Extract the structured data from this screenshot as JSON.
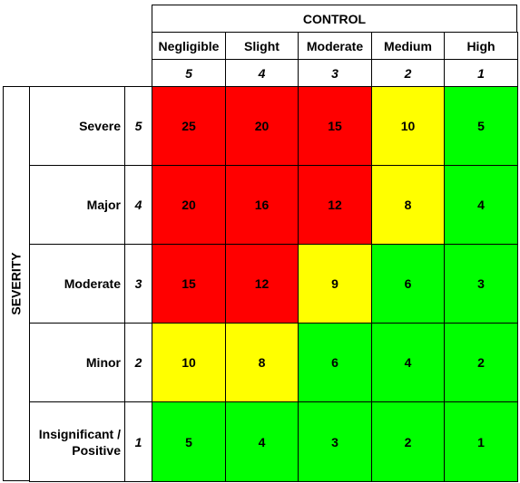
{
  "control": {
    "title": "CONTROL",
    "columns": [
      {
        "label": "Negligible",
        "score": "5"
      },
      {
        "label": "Slight",
        "score": "4"
      },
      {
        "label": "Moderate",
        "score": "3"
      },
      {
        "label": "Medium",
        "score": "2"
      },
      {
        "label": "High",
        "score": "1"
      }
    ]
  },
  "severity": {
    "title": "SEVERITY",
    "rows": [
      {
        "label": "Severe",
        "score": "5",
        "values": [
          "25",
          "20",
          "15",
          "10",
          "5"
        ],
        "colors": [
          "red",
          "red",
          "red",
          "yellow",
          "green"
        ]
      },
      {
        "label": "Major",
        "score": "4",
        "values": [
          "20",
          "16",
          "12",
          "8",
          "4"
        ],
        "colors": [
          "red",
          "red",
          "red",
          "yellow",
          "green"
        ]
      },
      {
        "label": "Moderate",
        "score": "3",
        "values": [
          "15",
          "12",
          "9",
          "6",
          "3"
        ],
        "colors": [
          "red",
          "red",
          "yellow",
          "green",
          "green"
        ]
      },
      {
        "label": "Minor",
        "score": "2",
        "values": [
          "10",
          "8",
          "6",
          "4",
          "2"
        ],
        "colors": [
          "yellow",
          "yellow",
          "green",
          "green",
          "green"
        ]
      },
      {
        "label": "Insignificant / Positive",
        "score": "1",
        "values": [
          "5",
          "4",
          "3",
          "2",
          "1"
        ],
        "colors": [
          "green",
          "green",
          "green",
          "green",
          "green"
        ]
      }
    ]
  },
  "palette": {
    "red": "#ff0000",
    "yellow": "#ffff00",
    "green": "#00ff00"
  }
}
